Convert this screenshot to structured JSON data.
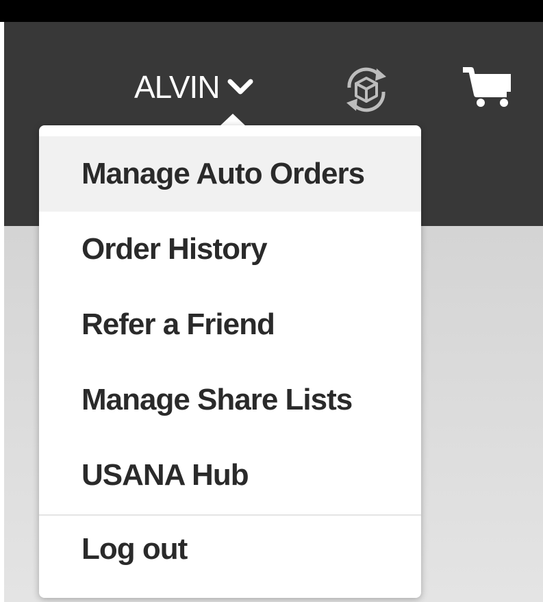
{
  "header": {
    "user_name": "ALVIN",
    "icons": {
      "dropdown": "chevron-down-icon",
      "auto_order": "auto-order-sync-icon",
      "cart": "shopping-cart-icon"
    }
  },
  "user_menu": {
    "items": [
      {
        "label": "Manage Auto Orders",
        "highlighted": true
      },
      {
        "label": "Order History",
        "highlighted": false
      },
      {
        "label": "Refer a Friend",
        "highlighted": false
      },
      {
        "label": "Manage Share Lists",
        "highlighted": false
      },
      {
        "label": "USANA Hub",
        "highlighted": false
      }
    ],
    "logout_label": "Log out"
  },
  "colors": {
    "header_bg": "#383838",
    "menu_bg": "#ffffff",
    "highlight_bg": "#f1f1f1",
    "menu_text": "#2a2a2a",
    "header_text": "#ffffff"
  }
}
